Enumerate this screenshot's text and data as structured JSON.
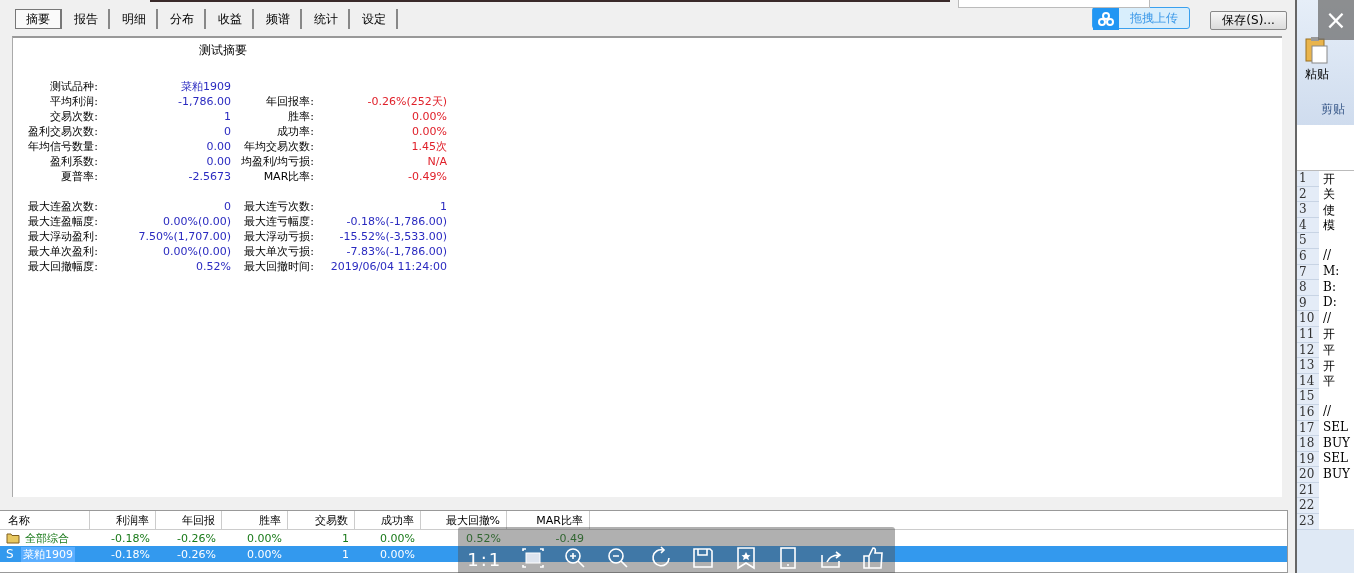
{
  "tabs": [
    {
      "label": "摘要",
      "selected": true
    },
    {
      "label": "报告",
      "selected": false
    },
    {
      "label": "明细",
      "selected": false
    },
    {
      "label": "分布",
      "selected": false
    },
    {
      "label": "收益",
      "selected": false
    },
    {
      "label": "频谱",
      "selected": false
    },
    {
      "label": "统计",
      "selected": false
    },
    {
      "label": "设定",
      "selected": false
    }
  ],
  "upload_button": {
    "label": "拖拽上传"
  },
  "save_button": {
    "label": "保存(S)..."
  },
  "summary": {
    "title": "测试摘要",
    "groups": [
      {
        "color": "#e0202a",
        "rows": [
          {
            "label": "测试品种:",
            "value": "菜粕1909"
          },
          {
            "label": "平均利润:",
            "value": "-1,786.00",
            "label2": "年回报率:",
            "value2": "-0.26%(252天)"
          },
          {
            "label": "交易次数:",
            "value": "1",
            "label2": "胜率:",
            "value2": "0.00%"
          },
          {
            "label": "盈利交易次数:",
            "value": "0",
            "label2": "成功率:",
            "value2": "0.00%"
          },
          {
            "label": "年均信号数量:",
            "value": "0.00",
            "label2": "年均交易次数:",
            "value2": "1.45次"
          },
          {
            "label": "盈利系数:",
            "value": "0.00",
            "label2": "均盈利/均亏损:",
            "value2": "N/A"
          },
          {
            "label": "夏普率:",
            "value": "-2.5673",
            "label2": "MAR比率:",
            "value2": "-0.49%"
          }
        ]
      },
      {
        "color": "#2a2ac0",
        "rows": [
          {
            "label": "最大连盈次数:",
            "value": "0",
            "label2": "最大连亏次数:",
            "value2": "1"
          },
          {
            "label": "最大连盈幅度:",
            "value": "0.00%(0.00)",
            "label2": "最大连亏幅度:",
            "value2": "-0.18%(-1,786.00)"
          },
          {
            "label": "最大浮动盈利:",
            "value": "7.50%(1,707.00)",
            "label2": "最大浮动亏损:",
            "value2": "-15.52%(-3,533.00)"
          },
          {
            "label": "最大单次盈利:",
            "value": "0.00%(0.00)",
            "label2": "最大单次亏损:",
            "value2": "-7.83%(-1,786.00)"
          },
          {
            "label": "最大回撤幅度:",
            "value": "0.52%",
            "label2": "最大回撤时间:",
            "value2": "2019/06/04 11:24:00"
          }
        ]
      }
    ]
  },
  "results_table": {
    "columns": [
      "名称",
      "利润率",
      "年回报",
      "胜率",
      "交易数",
      "成功率",
      "最大回撤%",
      "MAR比率"
    ],
    "rows": [
      {
        "kind": "group",
        "selected": false,
        "cells": [
          "全部综合",
          "-0.18%",
          "-0.26%",
          "0.00%",
          "1",
          "0.00%",
          "0.52%",
          "-0.49"
        ]
      },
      {
        "kind": "symbol",
        "marker": "S",
        "selected": true,
        "cells": [
          "菜粕1909",
          "-0.18%",
          "-0.26%",
          "0.00%",
          "1",
          "0.00%",
          "",
          ""
        ]
      }
    ]
  },
  "viewer_toolbar": {
    "zoom_label": "1:1"
  },
  "side_window": {
    "close_glyph": "×",
    "paste_label": "粘贴",
    "group_label": "剪贴",
    "sheet_rows": [
      {
        "number": "1",
        "text": "开"
      },
      {
        "number": "2",
        "text": "关"
      },
      {
        "number": "3",
        "text": "使"
      },
      {
        "number": "4",
        "text": "模"
      },
      {
        "number": "5"
      },
      {
        "number": "6",
        "text": "//"
      },
      {
        "number": "7",
        "text": "M:"
      },
      {
        "number": "8",
        "text": "B:"
      },
      {
        "number": "9",
        "text": "D:"
      },
      {
        "number": "10",
        "text": "//"
      },
      {
        "number": "11",
        "text": "开"
      },
      {
        "number": "12",
        "text": "平"
      },
      {
        "number": "13",
        "text": "开"
      },
      {
        "number": "14",
        "text": "平"
      },
      {
        "number": "15"
      },
      {
        "number": "16",
        "text": "//"
      },
      {
        "number": "17",
        "text": "SEL"
      },
      {
        "number": "18",
        "text": "BUY"
      },
      {
        "number": "19",
        "text": "SEL"
      },
      {
        "number": "20",
        "text": "BUY"
      },
      {
        "number": "21"
      },
      {
        "number": "22"
      },
      {
        "number": "23"
      }
    ]
  }
}
